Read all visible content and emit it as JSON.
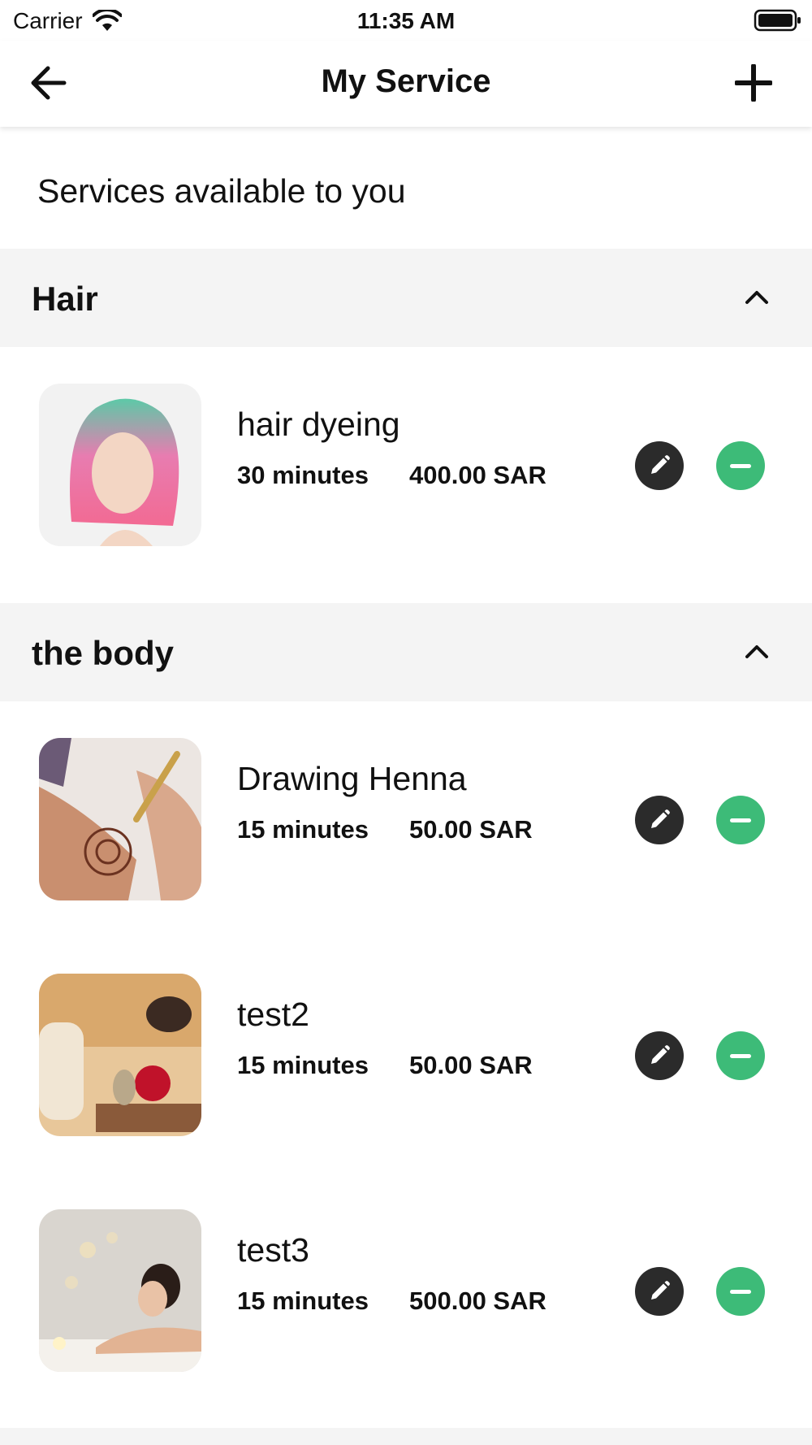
{
  "status_bar": {
    "carrier": "Carrier",
    "time": "11:35 AM"
  },
  "nav": {
    "title": "My Service",
    "back_icon": "arrow-left-icon",
    "add_icon": "plus-icon"
  },
  "subtitle": "Services available to you",
  "colors": {
    "edit": "#2b2b2b",
    "remove": "#3dbb78",
    "section_bg": "#f4f4f4"
  },
  "sections": [
    {
      "title": "Hair",
      "expanded": true,
      "services": [
        {
          "name": "hair dyeing",
          "duration": "30 minutes",
          "price": "400.00 SAR"
        }
      ]
    },
    {
      "title": "the body",
      "expanded": true,
      "services": [
        {
          "name": "Drawing Henna",
          "duration": "15 minutes",
          "price": "50.00 SAR"
        },
        {
          "name": "test2",
          "duration": "15 minutes",
          "price": "50.00 SAR"
        },
        {
          "name": "test3",
          "duration": "15 minutes",
          "price": "500.00 SAR"
        }
      ]
    }
  ]
}
